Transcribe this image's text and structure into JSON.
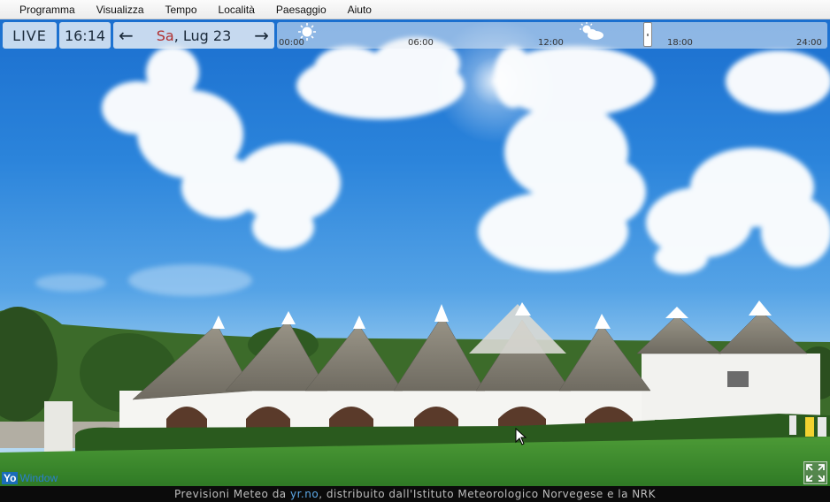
{
  "menu": {
    "items": [
      "Programma",
      "Visualizza",
      "Tempo",
      "Località",
      "Paesaggio",
      "Aiuto"
    ]
  },
  "controls": {
    "live_label": "LIVE",
    "time": "16:14",
    "day": "Sa",
    "date": ", Lug 23",
    "prev_icon": "arrow-left-icon",
    "next_icon": "arrow-right-icon"
  },
  "timeline": {
    "ticks": [
      "00:00",
      "06:00",
      "12:00",
      "18:00",
      "24:00"
    ],
    "icons": [
      "sun-icon",
      "partly-cloudy-icon"
    ],
    "current_position": 0.676
  },
  "footer": {
    "prefix": "Previsioni Meteo da ",
    "link": "yr.no",
    "suffix": ", distribuito dall'Istituto Meteorologico Norvegese e la NRK"
  },
  "logo": {
    "yo": "Yo",
    "rest": "Window"
  },
  "colors": {
    "sky": "#2b84db",
    "grass": "#3f8f2f",
    "day_accent": "#b03030",
    "link": "#5da9e8"
  }
}
